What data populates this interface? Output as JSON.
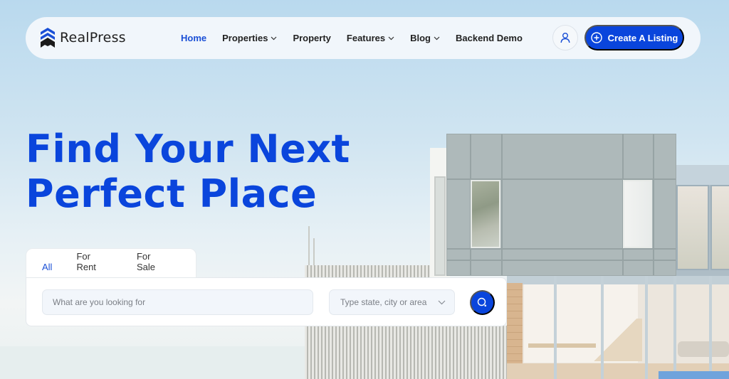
{
  "brand": {
    "name": "RealPress",
    "logo_icon": "stacked-chevrons-icon",
    "colors": {
      "primary": "#0a45dc",
      "logo_blue": "#1a4fd6",
      "logo_dark": "#1a1a1a"
    }
  },
  "nav": {
    "items": [
      {
        "label": "Home",
        "active": true,
        "has_dropdown": false
      },
      {
        "label": "Properties",
        "active": false,
        "has_dropdown": true
      },
      {
        "label": "Property",
        "active": false,
        "has_dropdown": false
      },
      {
        "label": "Features",
        "active": false,
        "has_dropdown": true
      },
      {
        "label": "Blog",
        "active": false,
        "has_dropdown": true
      },
      {
        "label": "Backend Demo",
        "active": false,
        "has_dropdown": false
      }
    ],
    "user_icon": "user-icon",
    "create_button": {
      "label": "Create A Listing",
      "icon": "plus-circle-icon"
    }
  },
  "hero": {
    "title_line1": "Find Your Next",
    "title_line2": "Perfect Place"
  },
  "search": {
    "tabs": [
      {
        "label": "All",
        "active": true
      },
      {
        "label": "For Rent",
        "active": false
      },
      {
        "label": "For Sale",
        "active": false
      }
    ],
    "keyword_placeholder": "What are you looking for",
    "keyword_value": "",
    "location_placeholder": "Type state, city or area",
    "location_icon": "chevron-down-icon",
    "submit_icon": "search-icon"
  },
  "background_image": "modern-house-photo"
}
